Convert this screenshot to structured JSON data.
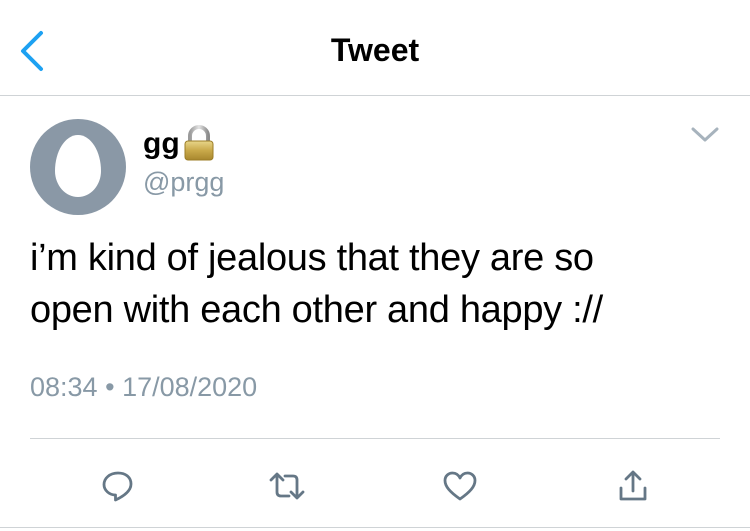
{
  "header": {
    "title": "Tweet",
    "back_icon": "chevron-left-icon",
    "accent_color": "#1da1f2"
  },
  "tweet": {
    "author": {
      "display_name": "gg",
      "handle": "@prgg",
      "protected": true,
      "avatar_icon": "default-egg-avatar"
    },
    "text_line1": "i’m kind of jealous that they are so",
    "text_line2": "open with each other and happy ://",
    "time": "08:34",
    "separator": "•",
    "date": "17/08/2020",
    "menu_icon": "chevron-down-icon"
  },
  "actions": [
    {
      "name": "reply",
      "icon": "reply-icon"
    },
    {
      "name": "retweet",
      "icon": "retweet-icon"
    },
    {
      "name": "like",
      "icon": "heart-icon"
    },
    {
      "name": "share",
      "icon": "share-icon"
    }
  ],
  "colors": {
    "text_primary": "#000000",
    "text_secondary": "#8899a6",
    "icon_gray": "#657786",
    "divider": "#cfd3d6",
    "avatar_bg": "#8a98a6"
  }
}
